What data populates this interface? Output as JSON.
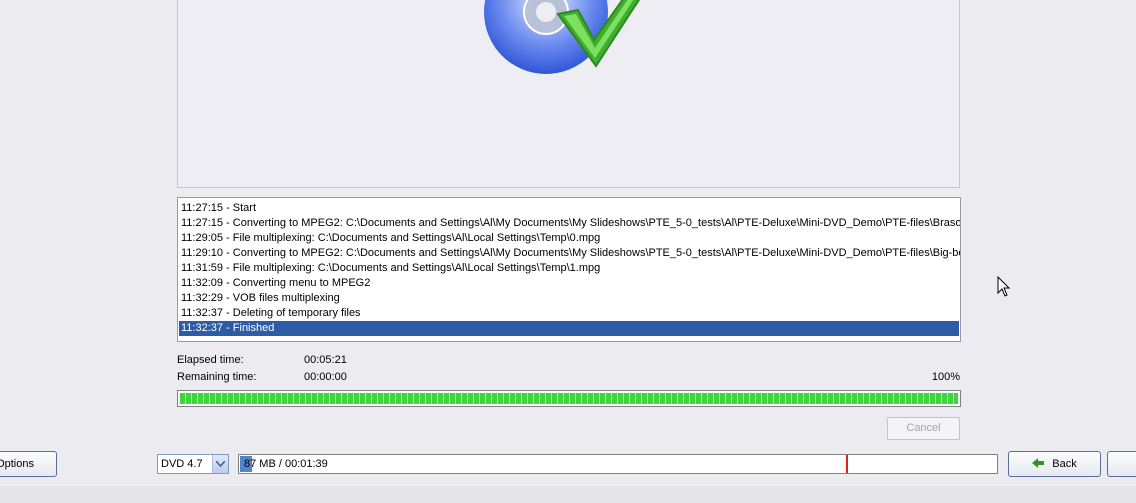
{
  "log": {
    "entries": [
      "11:27:15 - Start",
      "11:27:15 - Converting to MPEG2: C:\\Documents and Settings\\Al\\My Documents\\My Slideshows\\PTE_5-0_tests\\Al\\PTE-Deluxe\\Mini-DVD_Demo\\PTE-files\\Brasov_mini",
      "11:29:05 - File multiplexing: C:\\Documents and Settings\\Al\\Local Settings\\Temp\\0.mpg",
      "11:29:10 - Converting to MPEG2: C:\\Documents and Settings\\Al\\My Documents\\My Slideshows\\PTE_5-0_tests\\Al\\PTE-Deluxe\\Mini-DVD_Demo\\PTE-files\\Big-bend-mini",
      "11:31:59 - File multiplexing: C:\\Documents and Settings\\Al\\Local Settings\\Temp\\1.mpg",
      "11:32:09 - Converting menu to MPEG2",
      "11:32:29 - VOB files multiplexing",
      "11:32:37 - Deleting of temporary files",
      "11:32:37 - Finished"
    ]
  },
  "progress": {
    "elapsed_label": "Elapsed time:",
    "elapsed_value": "00:05:21",
    "remaining_label": "Remaining time:",
    "remaining_value": "00:00:00",
    "percent_label": "100%",
    "percent": 100
  },
  "buttons": {
    "cancel": "Cancel",
    "options": "Options",
    "back": "Back"
  },
  "disc": {
    "selected": "DVD 4.7",
    "size_text": "87 MB / 00:01:39"
  },
  "colors": {
    "progress": "#3ed63e",
    "selection": "#2d5ba6",
    "marker": "#e22121"
  }
}
